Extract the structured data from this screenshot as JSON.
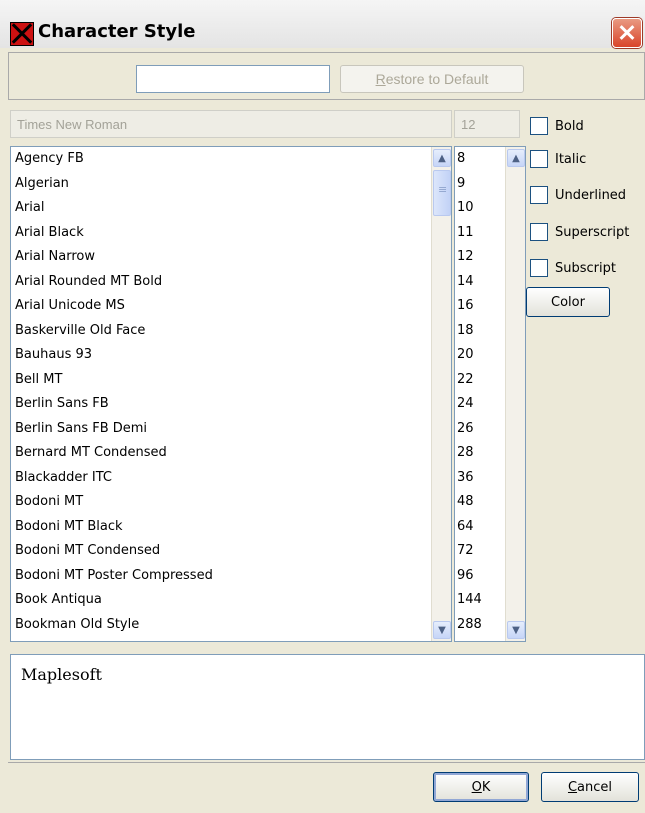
{
  "window": {
    "title": "Character Style"
  },
  "toolbar": {
    "name_value": "",
    "restore_label_u": "R",
    "restore_label_rest": "estore to Default"
  },
  "font_field": {
    "value": "Times New Roman"
  },
  "size_field": {
    "value": "12"
  },
  "font_list": [
    "Agency FB",
    "Algerian",
    "Arial",
    "Arial Black",
    "Arial Narrow",
    "Arial Rounded MT Bold",
    "Arial Unicode MS",
    "Baskerville Old Face",
    "Bauhaus 93",
    "Bell MT",
    "Berlin Sans FB",
    "Berlin Sans FB Demi",
    "Bernard MT Condensed",
    "Blackadder ITC",
    "Bodoni MT",
    "Bodoni MT Black",
    "Bodoni MT Condensed",
    "Bodoni MT Poster Compressed",
    "Book Antiqua",
    "Bookman Old Style"
  ],
  "size_list": [
    "8",
    "9",
    "10",
    "11",
    "12",
    "14",
    "16",
    "18",
    "20",
    "22",
    "24",
    "26",
    "28",
    "36",
    "48",
    "64",
    "72",
    "96",
    "144",
    "288"
  ],
  "styles": {
    "bold": "Bold",
    "italic": "Italic",
    "underlined": "Underlined",
    "superscript": "Superscript",
    "subscript": "Subscript",
    "color": "Color"
  },
  "preview": {
    "text": "Maplesoft"
  },
  "buttons": {
    "ok_u": "O",
    "ok_rest": "K",
    "cancel_u": "C",
    "cancel_rest": "ancel"
  }
}
